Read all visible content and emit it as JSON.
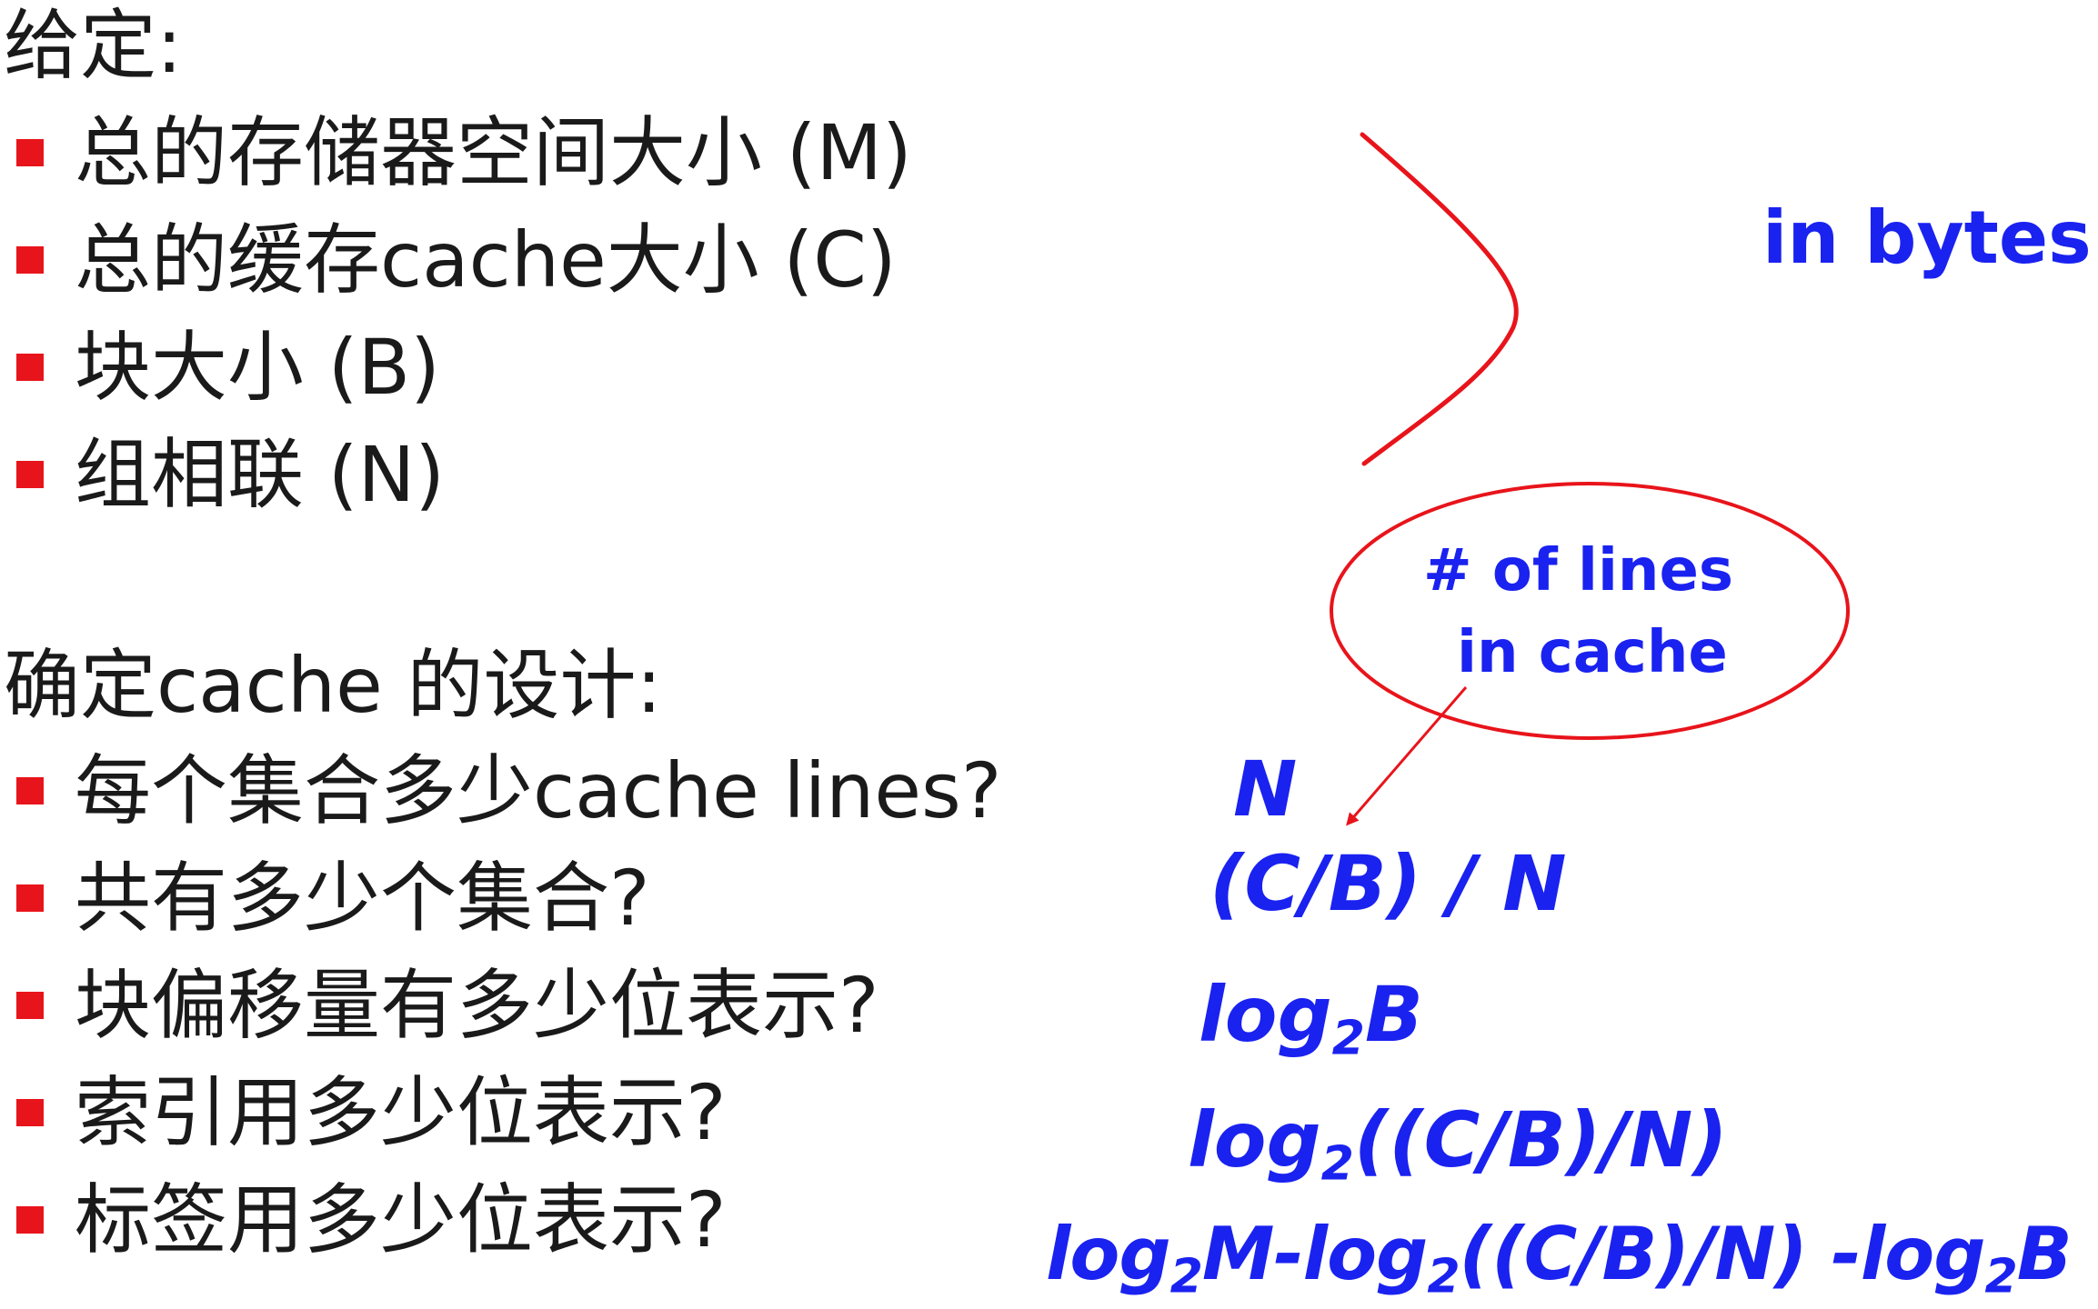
{
  "colors": {
    "text": "#1a1a1a",
    "bullet": "#e8141b",
    "annotation_blue": "#1a22f0",
    "annotation_red": "#e8141b"
  },
  "given": {
    "heading": "给定:",
    "items": [
      {
        "text": "总的存储器空间大小 (M)"
      },
      {
        "text": "总的缓存cache大小 (C)"
      },
      {
        "text": "块大小 (B)"
      },
      {
        "text": "组相联 (N)"
      }
    ],
    "brace_note": "in bytes"
  },
  "design": {
    "heading": "确定cache 的设计:",
    "items": [
      {
        "text": "每个集合多少cache lines?"
      },
      {
        "text": "共有多少个集合?"
      },
      {
        "text": "块偏移量有多少位表示?"
      },
      {
        "text": "索引用多少位表示?"
      },
      {
        "text": "标签用多少位表示?"
      }
    ],
    "circle_note": {
      "line1": "# of lines",
      "line2": "in cache"
    },
    "answers": {
      "a1": "N",
      "a2": "(C/B) / N",
      "a3_pre": "log",
      "a3_sub": "2",
      "a3_post": "B",
      "a4_pre": "log",
      "a4_sub": "2",
      "a4_post": "((C/B)/N)",
      "a5_p1": "log",
      "a5_s1": "2",
      "a5_p2": "M-log",
      "a5_s2": "2",
      "a5_p3": "((C/B)/N) -log",
      "a5_s3": "2",
      "a5_p4": "B"
    }
  }
}
